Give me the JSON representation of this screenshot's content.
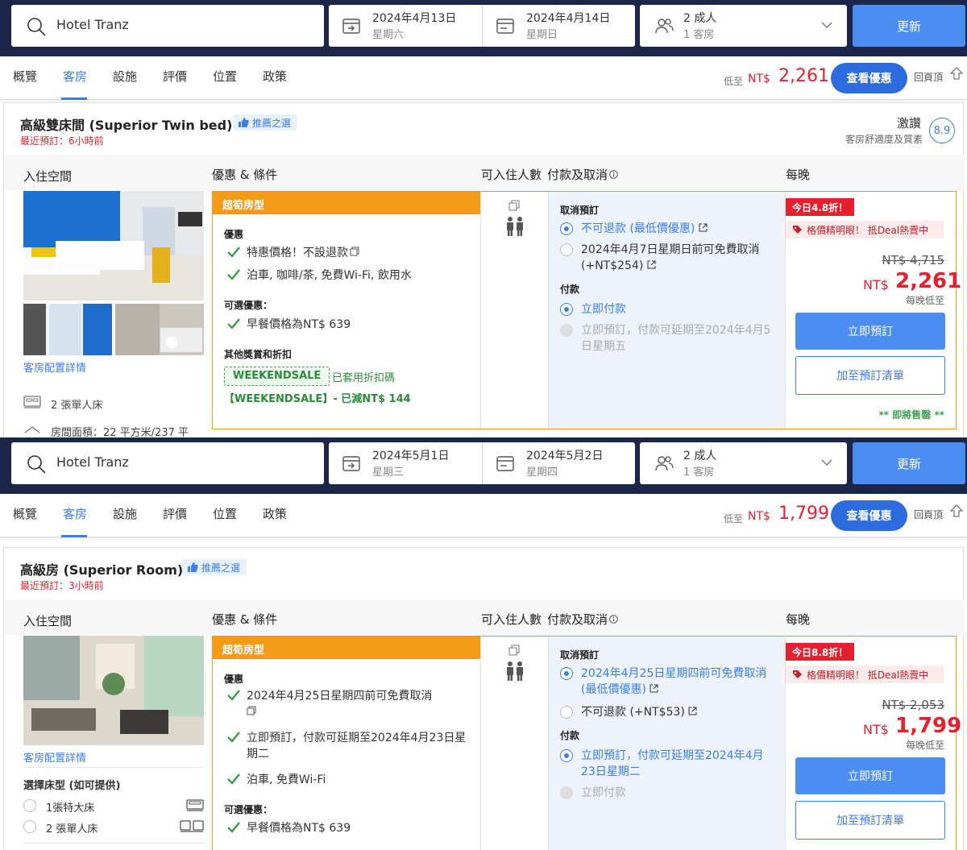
{
  "panels": [
    {
      "search": {
        "destination": "Hotel Tranz",
        "checkin_date": "2024年4月13日",
        "checkin_weekday": "星期六",
        "checkout_date": "2024年4月14日",
        "checkout_weekday": "星期日",
        "adults": "2 成人",
        "rooms": "1 客房",
        "update_label": "更新"
      },
      "tabs": {
        "items": [
          "概覽",
          "客房",
          "設施",
          "評價",
          "位置",
          "政策"
        ],
        "low_label": "低至",
        "low_currency": "NT$",
        "low_amount": "2,261",
        "deal_label": "查看優惠",
        "top_label": "回頁頂"
      },
      "room": {
        "title": "高級雙床間 (Superior Twin bed)",
        "recommend": "推薦之選",
        "recent": "最近預訂：6小時前",
        "rating_label": "激讚",
        "rating_sub": "客房舒適度及質素",
        "rating_score": "8.9",
        "col_space": "入住空間",
        "col_offer": "優惠 & 條件",
        "col_guests": "可入住人數",
        "col_pay": "付款及取消",
        "col_price": "每晚",
        "config_link": "客房配置詳情",
        "amenity_bed": "2 張單人床",
        "amenity_area": "房間面積：22 平方米/237 平",
        "promo": "超筍房型",
        "perks_label": "優惠",
        "perks": [
          "特惠價格！不設退款",
          "泊車, 咖啡/茶, 免費Wi-Fi, 飲用水"
        ],
        "optional_label": "可選優惠：",
        "optional": [
          "早餐價格為NT$ 639"
        ],
        "other_label": "其他獎賞和折扣",
        "coupon_code": "WEEKENDSALE",
        "coupon_applied": "已套用折扣碼",
        "coupon_line": "【WEEKENDSALE】- 已減NT$ 144",
        "cancel_label": "取消預訂",
        "cancel_opt1": "不可退款 (最低價優惠)",
        "cancel_opt2": "2024年4月7日星期日前可免費取消 (+NT$254)",
        "pay_label": "付款",
        "pay_opt1": "立即付款",
        "pay_opt2": "立即預訂，付款可延期至2024年4月5日星期五",
        "today_badge": "今日4.8折！",
        "hot_deal": "格價精明眼！ 抵Deal熱賣中",
        "old_price": "NT$ 4,715",
        "new_currency": "NT$",
        "new_amount": "2,261",
        "per_night": "每晚低至",
        "book_label": "立即預訂",
        "wish_label": "加至預訂清單",
        "soldout": "** 即將售罄 **"
      }
    },
    {
      "search": {
        "destination": "Hotel Tranz",
        "checkin_date": "2024年5月1日",
        "checkin_weekday": "星期三",
        "checkout_date": "2024年5月2日",
        "checkout_weekday": "星期四",
        "adults": "2 成人",
        "rooms": "1 客房",
        "update_label": "更新"
      },
      "tabs": {
        "items": [
          "概覽",
          "客房",
          "設施",
          "評價",
          "位置",
          "政策"
        ],
        "low_label": "低至",
        "low_currency": "NT$",
        "low_amount": "1,799",
        "deal_label": "查看優惠",
        "top_label": "回頁頂"
      },
      "room": {
        "title": "高級房 (Superior Room)",
        "recommend": "推薦之選",
        "recent": "最近預訂：3小時前",
        "col_space": "入住空間",
        "col_offer": "優惠 & 條件",
        "col_guests": "可入住人數",
        "col_pay": "付款及取消",
        "col_price": "每晚",
        "config_link": "客房配置詳情",
        "bed_choice_label": "選擇床型 (如可提供)",
        "bed_opt1": "1張特大床",
        "bed_opt2": "2 張單人床",
        "promo": "超筍房型",
        "perks_label": "優惠",
        "perks": [
          "2024年4月25日星期四前可免費取消",
          "立即預訂，付款可延期至2024年4月23日星期二",
          "泊車, 免費Wi-Fi"
        ],
        "optional_label": "可選優惠：",
        "optional": [
          "早餐價格為NT$ 639"
        ],
        "cancel_label": "取消預訂",
        "cancel_opt1": "2024年4月25日星期四前可免費取消 (最低價優惠)",
        "cancel_opt2": "不可退款 (+NT$53)",
        "pay_label": "付款",
        "pay_opt1": "立即預訂，付款可延期至2024年4月23日星期二",
        "pay_opt2": "立即付款",
        "today_badge": "今日8.8折！",
        "hot_deal": "格價精明眼！ 抵Deal熱賣中",
        "old_price": "NT$ 2,053",
        "new_currency": "NT$",
        "new_amount": "1,799",
        "per_night": "每晚低至",
        "book_label": "立即預訂",
        "wish_label": "加至預訂清單"
      }
    }
  ],
  "colors": {
    "navy": "#1b2648",
    "blue": "#4b8df1",
    "accent": "#3a7ee8",
    "orange": "#f39a16",
    "red": "#e5202e",
    "green": "#2a8b3a"
  },
  "icons": [
    "search-icon",
    "calendar-checkin-icon",
    "calendar-checkout-icon",
    "guests-icon",
    "chevron-down-icon",
    "thumbs-up-icon",
    "back-to-top-icon",
    "check-icon",
    "external-link-icon",
    "people-icon",
    "copy-icon",
    "tag-icon",
    "bed-icon",
    "house-icon",
    "info-icon"
  ]
}
